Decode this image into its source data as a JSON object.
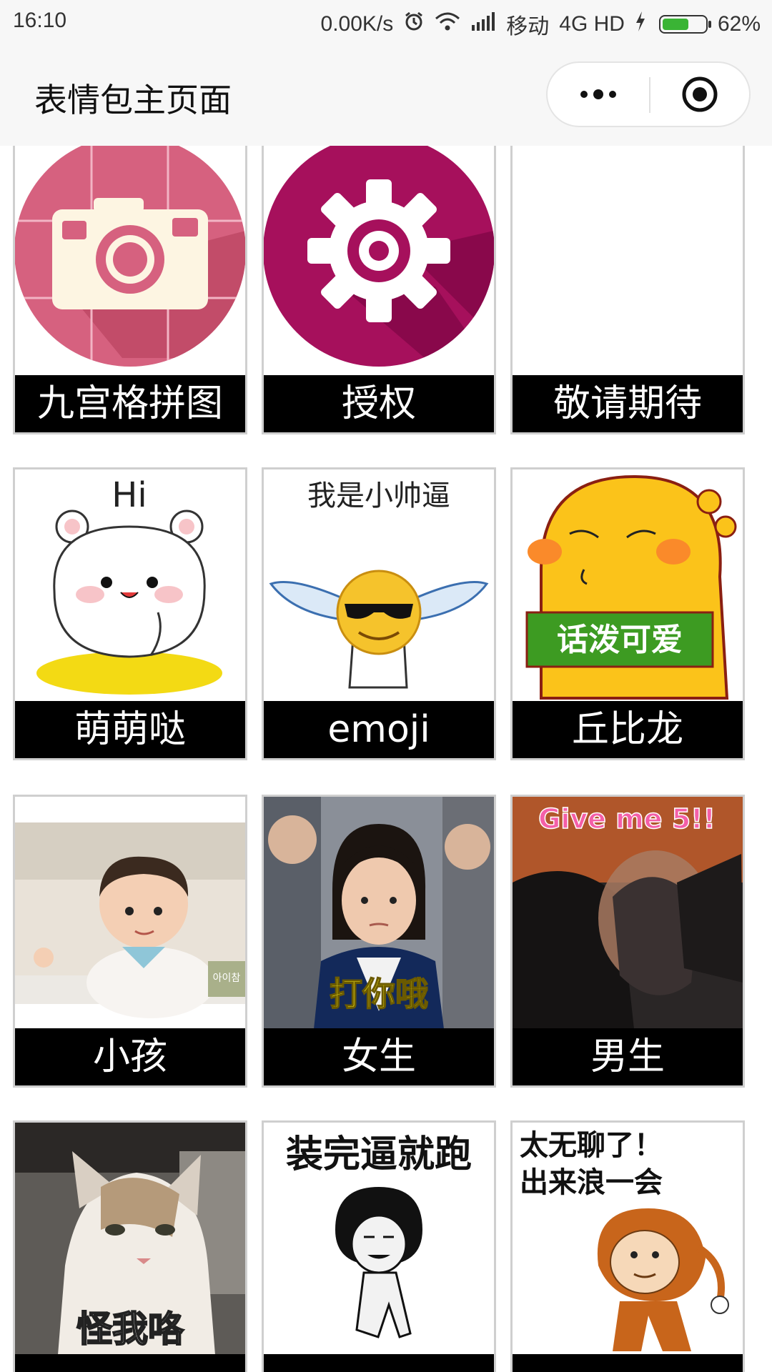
{
  "status_bar": {
    "time": "16:10",
    "speed": "0.00K/s",
    "carrier": "移动",
    "network": "4G HD",
    "battery": "62%",
    "battery_level": 0.62
  },
  "nav": {
    "title": "表情包主页面"
  },
  "grid": {
    "items": [
      {
        "label": "九宫格拼图"
      },
      {
        "label": "授权"
      },
      {
        "label": "敬请期待"
      },
      {
        "label": "萌萌哒",
        "image_text": "Hi"
      },
      {
        "label": "emoji",
        "image_text": "我是小帅逼"
      },
      {
        "label": "丘比龙",
        "image_text": "话泼可爱"
      },
      {
        "label": "小孩",
        "image_text": "아이참"
      },
      {
        "label": "女生",
        "image_text": "打你哦"
      },
      {
        "label": "男生",
        "image_text": "Give me 5!!"
      },
      {
        "label": "",
        "image_text": "怪我咯"
      },
      {
        "label": "",
        "image_text": "装完逼就跑"
      },
      {
        "label": "",
        "image_text": "太无聊了！出来浪一会"
      }
    ]
  },
  "colors": {
    "camera_circle": "#d6617f",
    "settings_circle": "#a6105c",
    "label_bg": "#000000",
    "chrome_bg": "#f7f7f7"
  }
}
